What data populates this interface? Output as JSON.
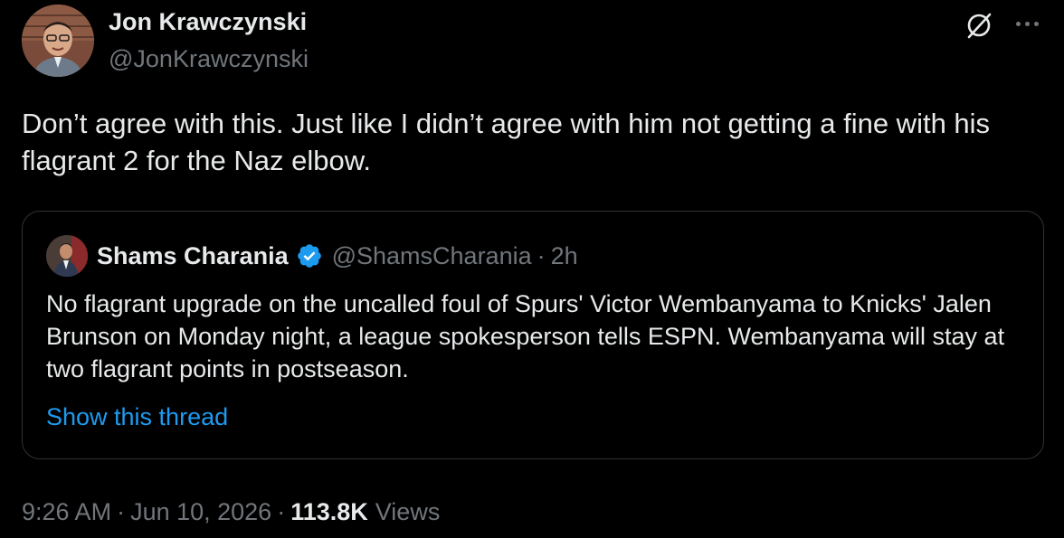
{
  "author": {
    "name": "Jon Krawczynski",
    "handle": "@JonKrawczynski"
  },
  "tweet": {
    "text": "Don’t agree with this. Just like I didn’t agree with him not getting a fine with his flagrant 2 for the Naz elbow."
  },
  "icons": {
    "grok": "grok-icon",
    "more": "more-options-icon",
    "verified": "verified-badge-icon"
  },
  "quote": {
    "name": "Shams Charania",
    "handle": "@ShamsCharania",
    "separator": "·",
    "time": "2h",
    "text": "No flagrant upgrade on the uncalled foul of Spurs' Victor Wembanyama to Knicks' Jalen Brunson on Monday night, a league spokesperson tells ESPN. Wembanyama will stay at two flagrant points in postseason.",
    "show_thread": "Show this thread"
  },
  "meta": {
    "time": "9:26 AM",
    "separator": "·",
    "date": "Jun 10, 2026",
    "views_count": "113.8K",
    "views_label": "Views"
  },
  "colors": {
    "background": "#000000",
    "text": "#e7e9ea",
    "muted": "#71767b",
    "link": "#1d9bf0",
    "border": "#2f3336",
    "verified": "#1d9bf0"
  }
}
